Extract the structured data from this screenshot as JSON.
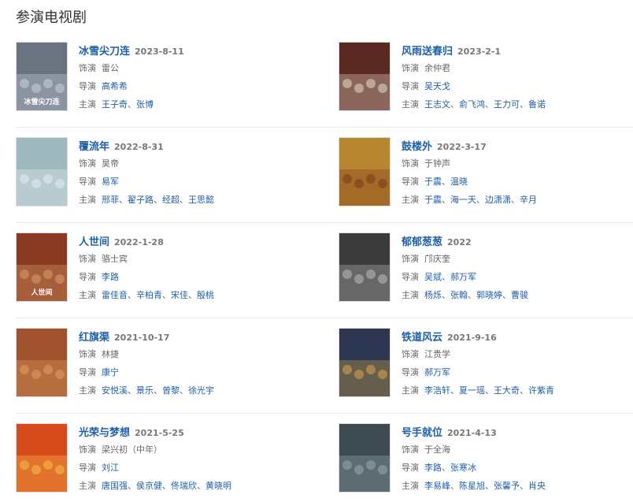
{
  "section_title": "参演电视剧",
  "labels": {
    "role": "饰演",
    "director": "导演",
    "cast": "主演",
    "sep": "、"
  },
  "dramas": [
    {
      "title": "冰雪尖刀连",
      "date": "2023-8-11",
      "role": "雷公",
      "role_link": false,
      "directors": [
        "高希希"
      ],
      "cast": [
        "王子奇",
        "张博"
      ],
      "poster": {
        "bg": "#6a7480",
        "accent": "#c9d2dc",
        "text": "冰雪尖刀连"
      }
    },
    {
      "title": "风雨送春归",
      "date": "2023-2-1",
      "role": "余仲君",
      "role_link": false,
      "directors": [
        "吴天戈"
      ],
      "cast": [
        "王志文",
        "俞飞鸿",
        "王力可",
        "鲁诺"
      ],
      "poster": {
        "bg": "#5a2a22",
        "accent": "#e8d8c8",
        "text": ""
      }
    },
    {
      "title": "覆流年",
      "date": "2022-8-31",
      "role": "昊帝",
      "role_link": false,
      "directors": [
        "易军"
      ],
      "cast": [
        "邢菲",
        "翟子路",
        "经超",
        "王思懿"
      ],
      "poster": {
        "bg": "#9fb8bf",
        "accent": "#e6eef0",
        "text": ""
      }
    },
    {
      "title": "鼓楼外",
      "date": "2022-3-17",
      "role": "于钟声",
      "role_link": false,
      "directors": [
        "于震",
        "温晓"
      ],
      "cast": [
        "于震",
        "海一天",
        "边潇潇",
        "辛月"
      ],
      "poster": {
        "bg": "#b8862e",
        "accent": "#7a3a1a",
        "text": ""
      }
    },
    {
      "title": "人世间",
      "date": "2022-1-28",
      "role": "骆士宾",
      "role_link": false,
      "directors": [
        "李路"
      ],
      "cast": [
        "雷佳音",
        "辛柏青",
        "宋佳",
        "殷桃"
      ],
      "poster": {
        "bg": "#8a3a22",
        "accent": "#d9a36a",
        "text": "人世间"
      }
    },
    {
      "title": "郁郁葱葱",
      "date": "2022",
      "role": "邝庆奎",
      "role_link": false,
      "directors": [
        "吴斌",
        "郝万军"
      ],
      "cast": [
        "杨烁",
        "张翰",
        "郭晓婷",
        "曹骏"
      ],
      "poster": {
        "bg": "#3a3a3a",
        "accent": "#bdbdbd",
        "text": ""
      }
    },
    {
      "title": "红旗渠",
      "date": "2021-10-17",
      "role": "林捷",
      "role_link": false,
      "directors": [
        "康宁"
      ],
      "cast": [
        "安悦溪",
        "景乐",
        "曾黎",
        "徐光宇"
      ],
      "poster": {
        "bg": "#a0522d",
        "accent": "#e0a060",
        "text": ""
      }
    },
    {
      "title": "铁道风云",
      "date": "2021-9-16",
      "role": "江贵学",
      "role_link": false,
      "directors": [
        "郝万军"
      ],
      "cast": [
        "李浩轩",
        "夏一瑶",
        "王大奇",
        "许紫青"
      ],
      "poster": {
        "bg": "#2c3650",
        "accent": "#d8a548",
        "text": ""
      }
    },
    {
      "title": "光荣与梦想",
      "date": "2021-5-25",
      "role": "梁兴初（中年）",
      "role_link": false,
      "directors": [
        "刘江"
      ],
      "cast": [
        "唐国强",
        "侯京健",
        "佟瑞欣",
        "黄晓明"
      ],
      "poster": {
        "bg": "#d64a1c",
        "accent": "#f5c04a",
        "text": ""
      }
    },
    {
      "title": "号手就位",
      "date": "2021-4-13",
      "role": "于全海",
      "role_link": false,
      "directors": [
        "李路",
        "张寒冰"
      ],
      "cast": [
        "李易峰",
        "陈星旭",
        "张馨予",
        "肖央"
      ],
      "poster": {
        "bg": "#3d4a52",
        "accent": "#9aa8b0",
        "text": ""
      }
    }
  ]
}
